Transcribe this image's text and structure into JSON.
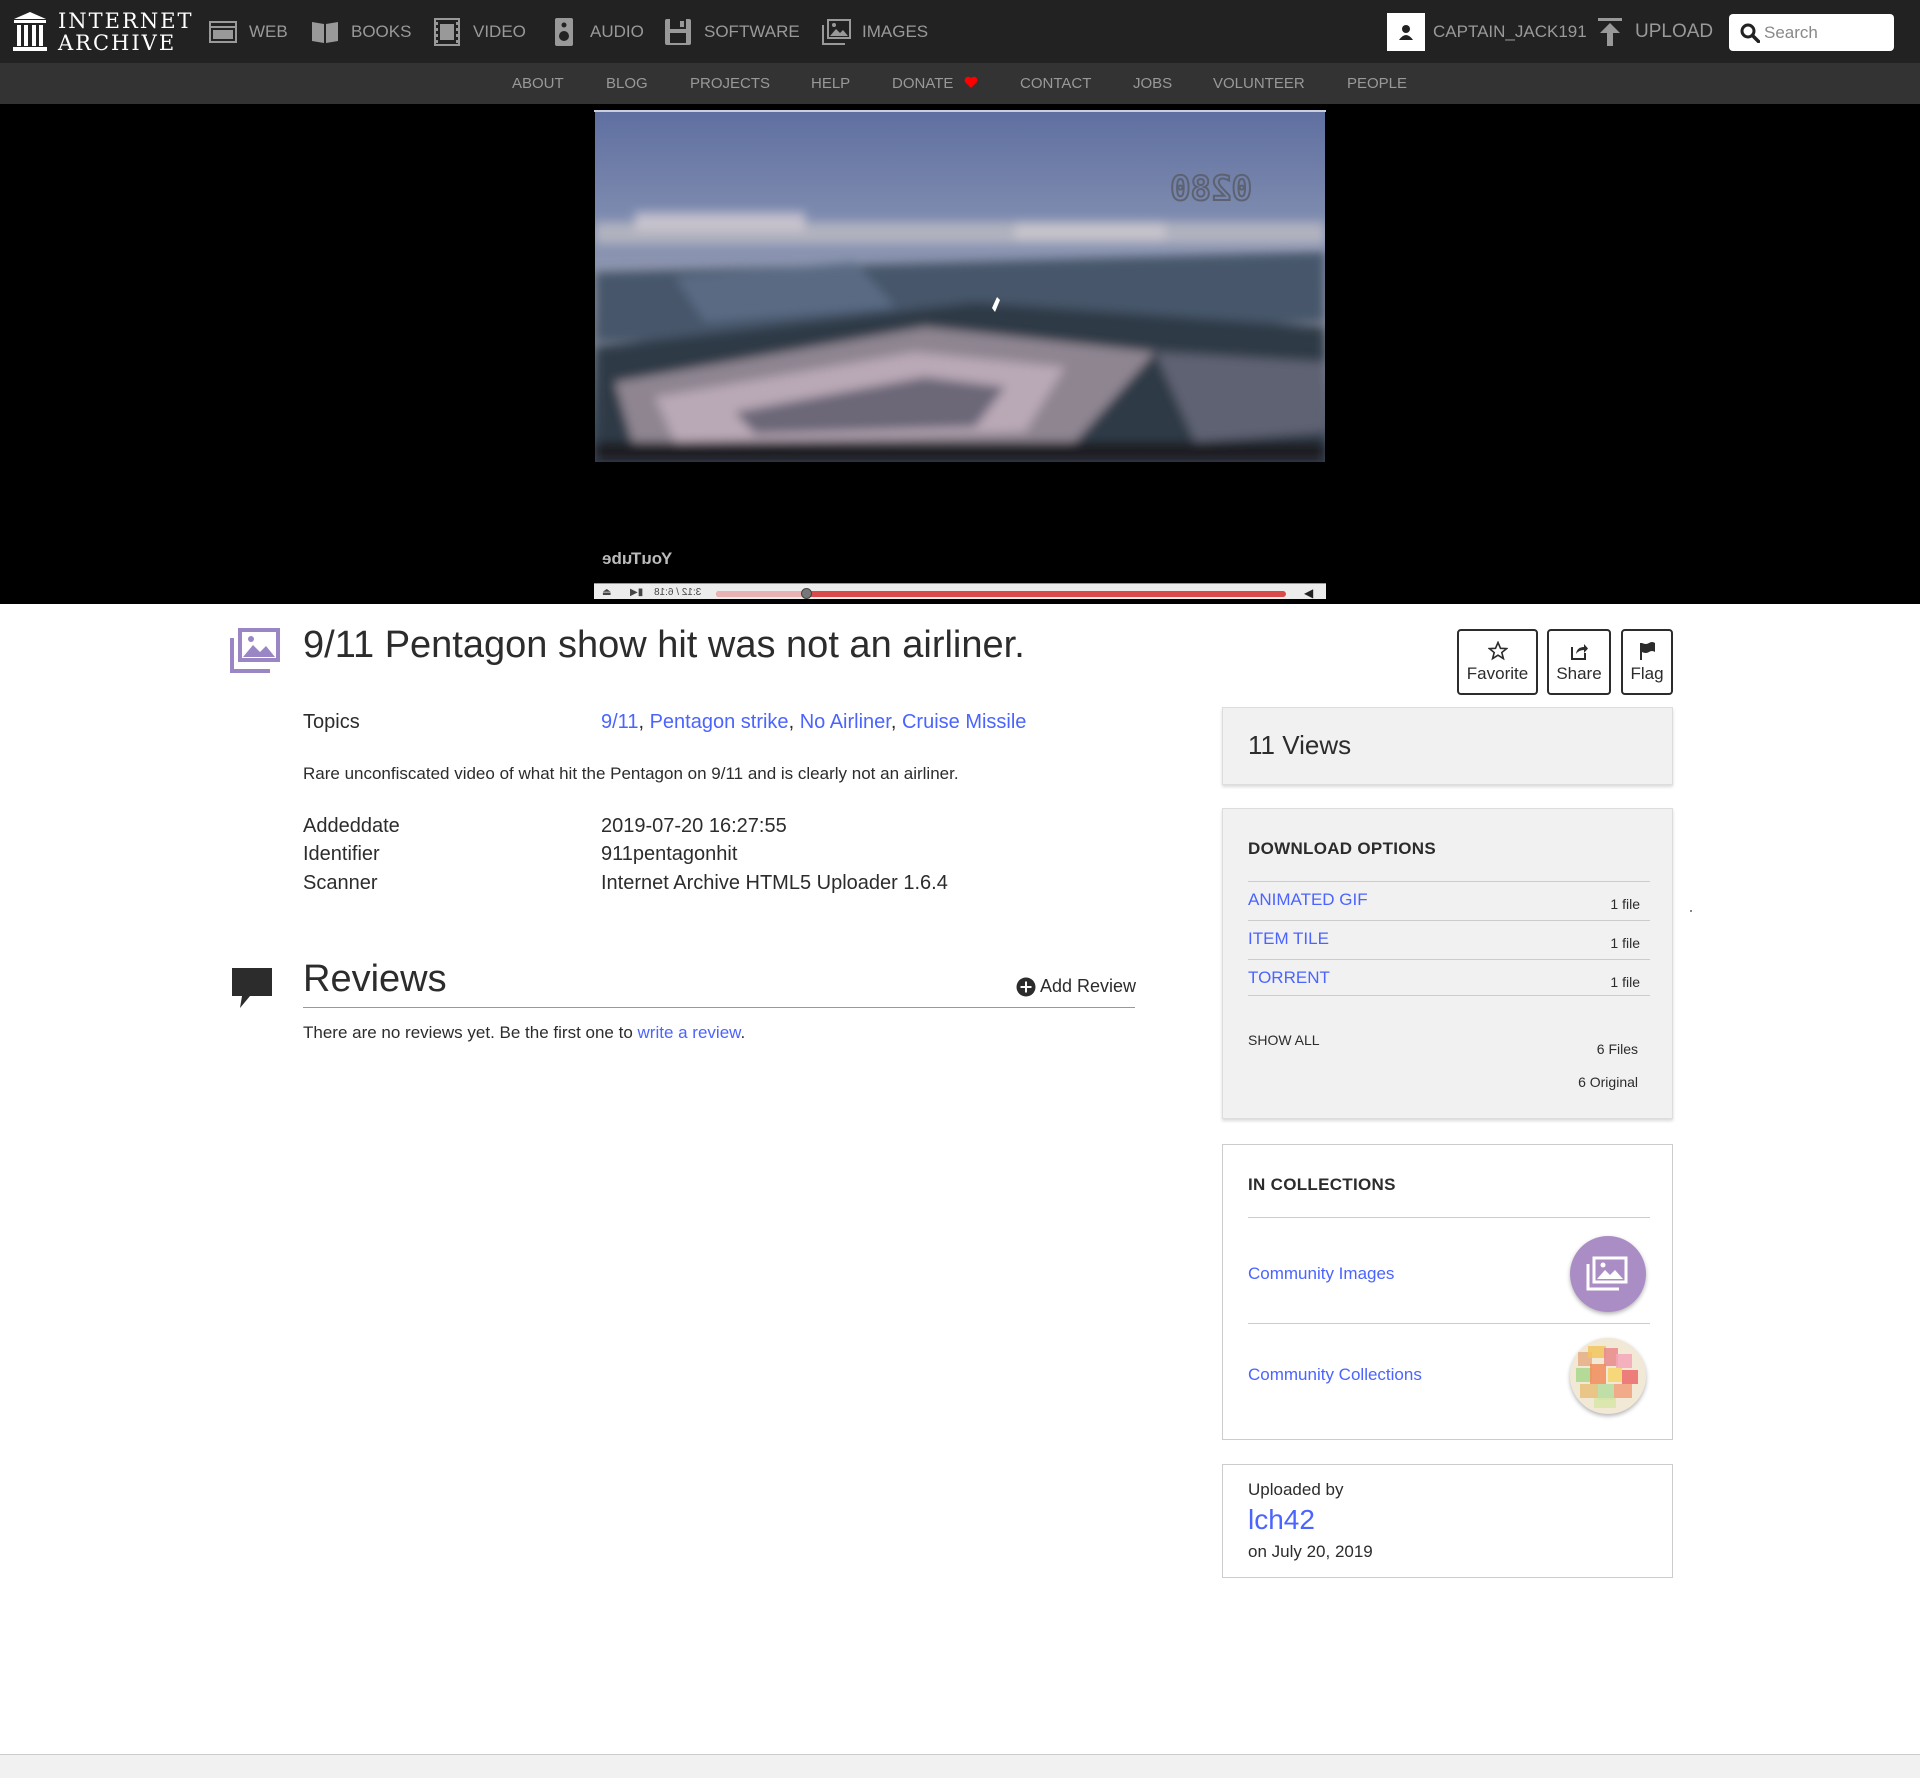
{
  "nav": {
    "logo_line1": "INTERNET",
    "logo_line2": "ARCHIVE",
    "media_tabs": [
      {
        "label": "WEB",
        "icon": "web-icon"
      },
      {
        "label": "BOOKS",
        "icon": "books-icon"
      },
      {
        "label": "VIDEO",
        "icon": "video-icon"
      },
      {
        "label": "AUDIO",
        "icon": "audio-icon"
      },
      {
        "label": "SOFTWARE",
        "icon": "software-icon"
      },
      {
        "label": "IMAGES",
        "icon": "images-icon"
      }
    ],
    "username": "CAPTAIN_JACK191",
    "upload_label": "UPLOAD",
    "search_placeholder": "Search"
  },
  "subnav": [
    "ABOUT",
    "BLOG",
    "PROJECTS",
    "HELP",
    "DONATE",
    "CONTACT",
    "JOBS",
    "VOLUNTEER",
    "PEOPLE"
  ],
  "player": {
    "overlay_text": "0280",
    "brand": "YouTube",
    "brand_mirrored": "You Tube",
    "time": "3:12 / 6:18",
    "progress_fraction": 0.16,
    "buffer_fraction": 1.0
  },
  "item": {
    "title": "9/11 Pentagon show hit was not an airliner.",
    "actions": {
      "favorite": "Favorite",
      "share": "Share",
      "flag": "Flag"
    },
    "topics_label": "Topics",
    "topics": [
      "9/11",
      "Pentagon strike",
      "No Airliner",
      "Cruise Missile"
    ],
    "description": "Rare unconfiscated video of what hit the Pentagon on 9/11 and is clearly not an airliner.",
    "metadata": [
      {
        "label": "Addeddate",
        "value": "2019-07-20 16:27:55"
      },
      {
        "label": "Identifier",
        "value": "911pentagonhit"
      },
      {
        "label": "Scanner",
        "value": "Internet Archive HTML5 Uploader 1.6.4"
      }
    ]
  },
  "reviews": {
    "title": "Reviews",
    "add_label": "Add Review",
    "empty_prefix": "There are no reviews yet. Be the first one to",
    "empty_link": "write a review",
    "empty_suffix": "."
  },
  "sidebar": {
    "views": "11 Views",
    "download_heading": "DOWNLOAD OPTIONS",
    "downloads": [
      {
        "format": "ANIMATED GIF",
        "count": "1 file"
      },
      {
        "format": "ITEM TILE",
        "count": "1 file"
      },
      {
        "format": "TORRENT",
        "count": "1 file"
      }
    ],
    "show_all": "SHOW ALL",
    "files_count": "6 Files",
    "original_count": "6 Original",
    "collections_heading": "IN COLLECTIONS",
    "collections": [
      {
        "name": "Community Images"
      },
      {
        "name": "Community Collections"
      }
    ],
    "uploaded_by_label": "Uploaded by",
    "uploader": "lch42",
    "upload_date": "on July 20, 2019"
  },
  "colors": {
    "link": "#4b64ff",
    "nav_bg": "#222222",
    "subnav_bg": "#333333",
    "image_accent": "#9a86c4",
    "donate_heart": "#ff0000"
  }
}
